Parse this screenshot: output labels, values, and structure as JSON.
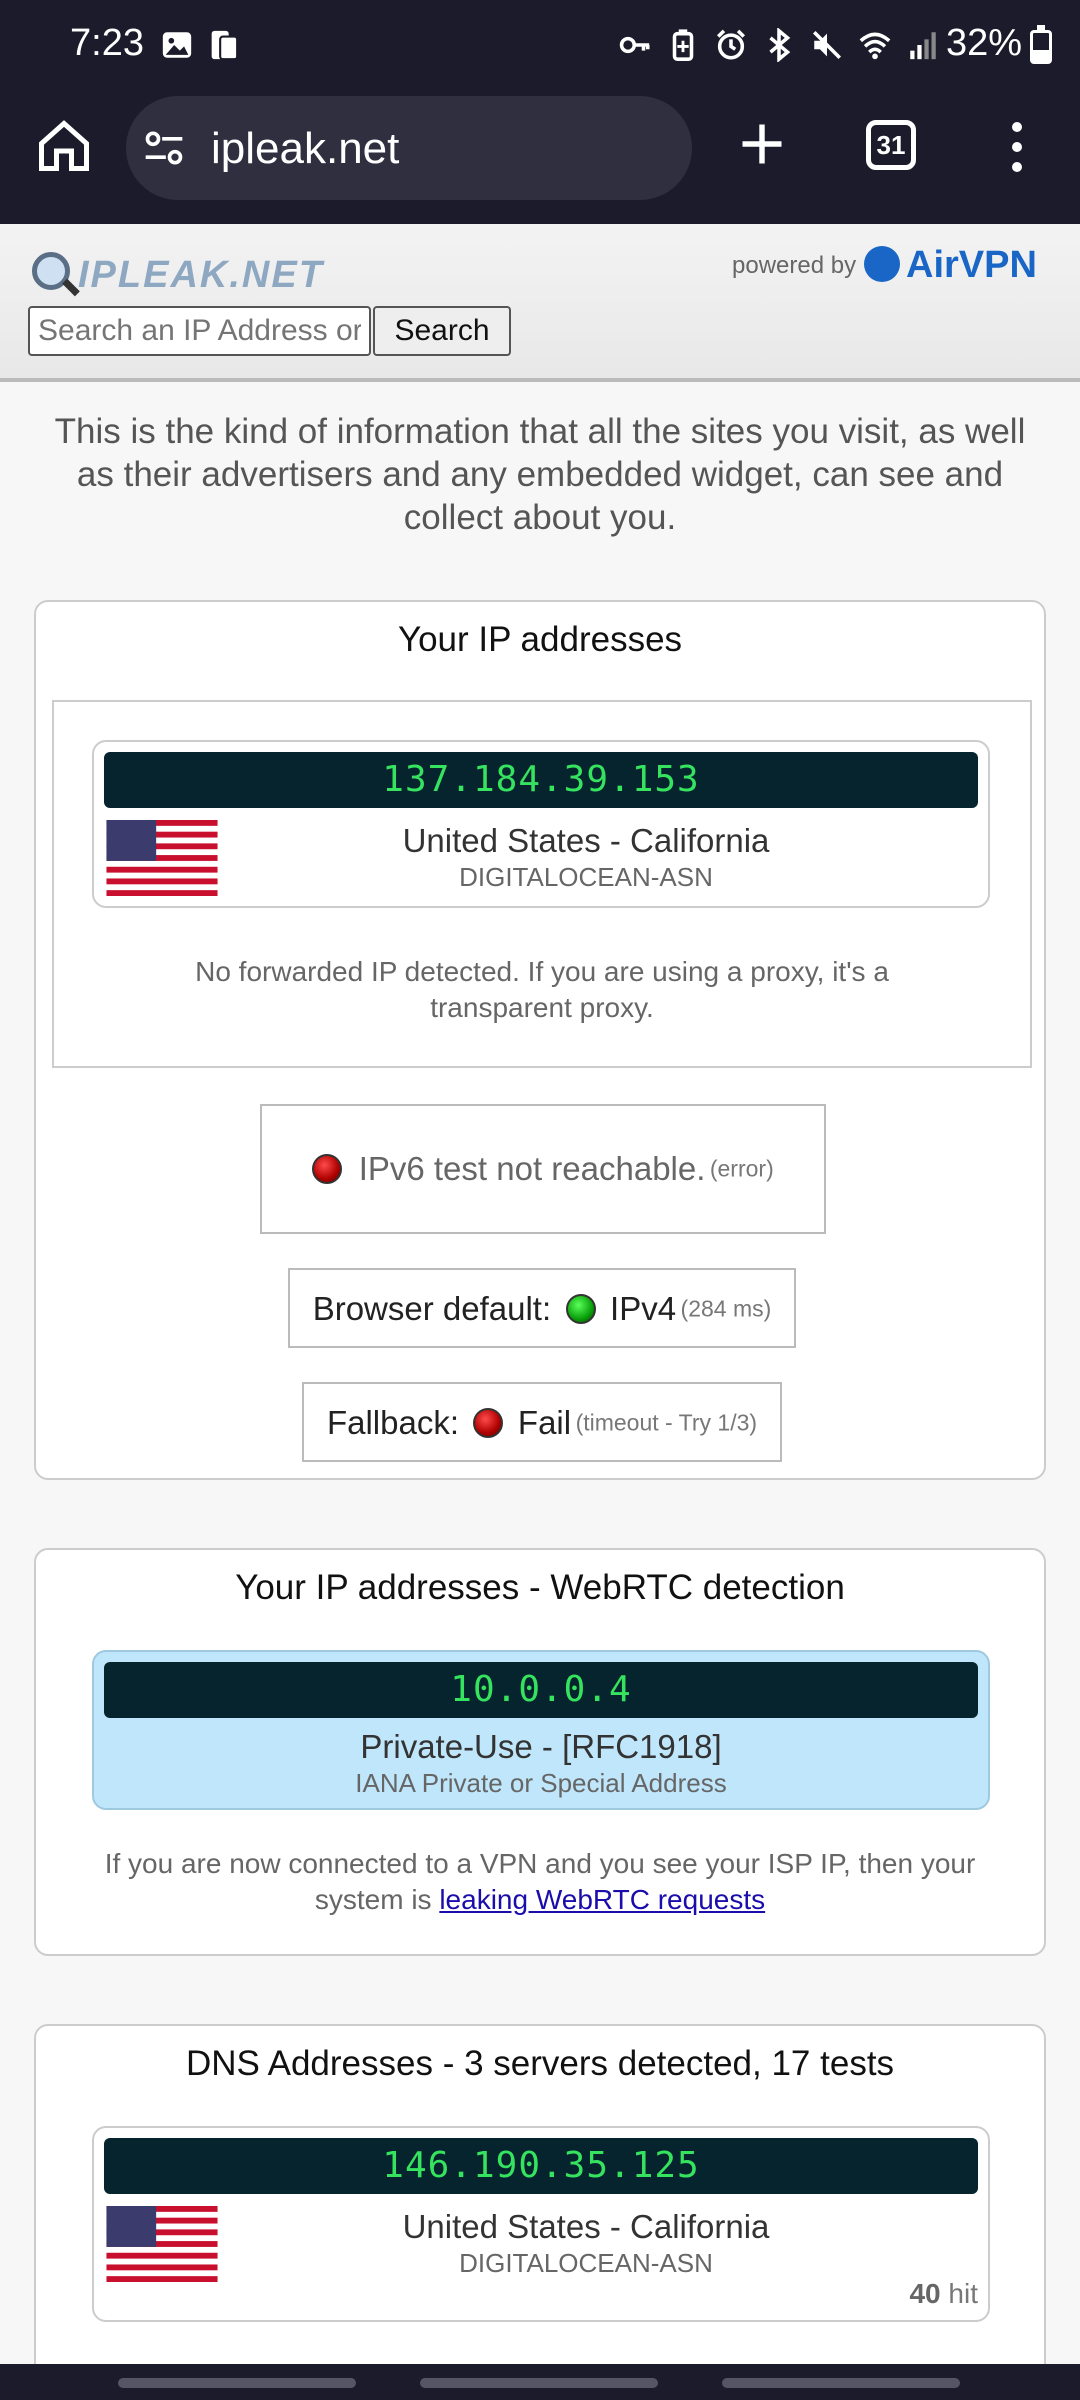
{
  "status_bar": {
    "time": "7:23",
    "battery": "32%",
    "battery_level": 0.32,
    "icons": [
      "image-icon",
      "dual-sim-icon",
      "key-icon",
      "battery-saver-icon",
      "alarm-icon",
      "bluetooth-icon",
      "mute-icon",
      "wifi-icon",
      "signal-icon"
    ]
  },
  "browser": {
    "url": "ipleak.net",
    "tab_count": "31"
  },
  "header": {
    "logo": "IPLEAK.NET",
    "powered_by": "powered by",
    "brand": "AirVPN",
    "search_placeholder": "Search an IP Address or Domain",
    "search_button": "Search"
  },
  "intro": "This is the kind of information that all the sites you visit, as well as their advertisers and any embedded widget, can see and collect about you.",
  "ip_section": {
    "title": "Your IP addresses",
    "ip": "137.184.39.153",
    "location": "United States - California",
    "isp": "DIGITALOCEAN-ASN",
    "forward_note": "No forwarded IP detected. If you are using a proxy, it's a transparent proxy.",
    "ipv6_label": "IPv6 test not reachable.",
    "ipv6_detail": "(error)",
    "browser_default_label": "Browser default:",
    "browser_default_value": "IPv4",
    "browser_default_detail": "(284 ms)",
    "fallback_label": "Fallback:",
    "fallback_value": "Fail",
    "fallback_detail": "(timeout - Try 1/3)"
  },
  "webrtc_section": {
    "title": "Your IP addresses - WebRTC detection",
    "ip": "10.0.0.4",
    "label": "Private-Use - [RFC1918]",
    "sub": "IANA Private or Special Address",
    "note_prefix": "If you are now connected to a VPN and you see your ISP IP, then your system is",
    "note_link": "leaking WebRTC requests"
  },
  "dns_section": {
    "title": "DNS Addresses - 3 servers detected, 17 tests",
    "ip": "146.190.35.125",
    "location": "United States - California",
    "isp": "DIGITALOCEAN-ASN",
    "hits": "40",
    "hits_label": "hit"
  },
  "colors": {
    "ip_text": "#35e35e",
    "ip_bar": "#05242e",
    "brand": "#1a66c7",
    "link": "#1a0dab",
    "webrtc_panel": "#bfe6fb"
  }
}
